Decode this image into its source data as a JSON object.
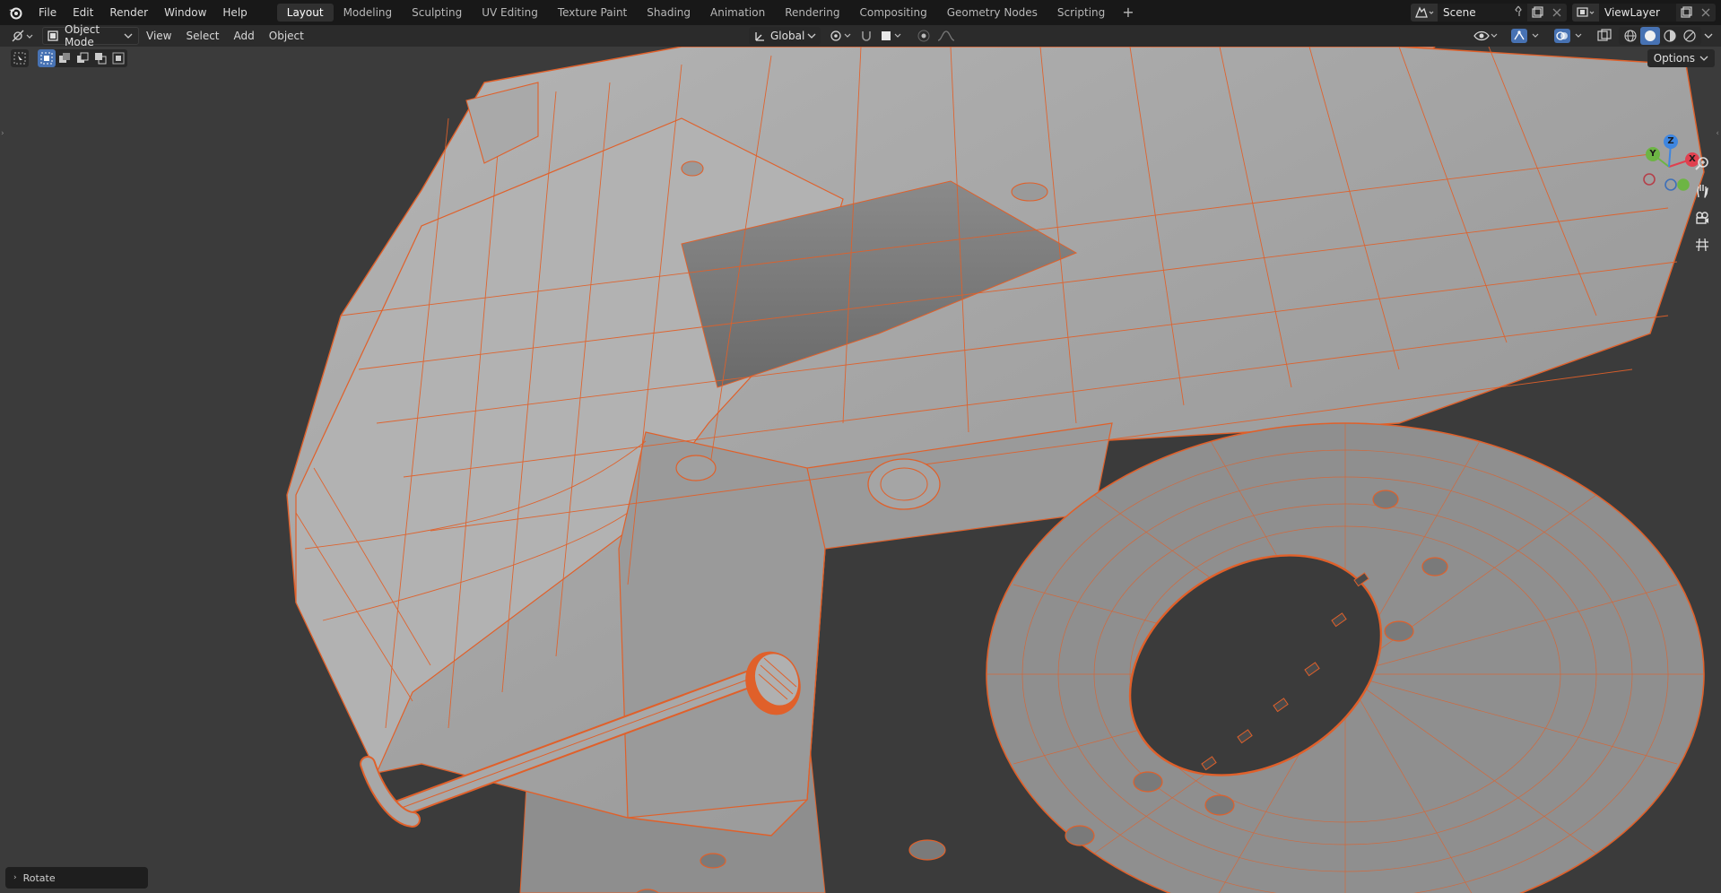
{
  "topbar": {
    "menus": [
      "File",
      "Edit",
      "Render",
      "Window",
      "Help"
    ],
    "workspaces": [
      "Layout",
      "Modeling",
      "Sculpting",
      "UV Editing",
      "Texture Paint",
      "Shading",
      "Animation",
      "Rendering",
      "Compositing",
      "Geometry Nodes",
      "Scripting"
    ],
    "active_workspace": "Layout",
    "add_tab_label": "+",
    "scene_name": "Scene",
    "view_layer_name": "ViewLayer"
  },
  "header": {
    "mode": "Object Mode",
    "menus": [
      "View",
      "Select",
      "Add",
      "Object"
    ],
    "orientation": "Global"
  },
  "toolbar": {
    "options_label": "Options"
  },
  "gizmo": {
    "x_label": "X",
    "y_label": "Y",
    "z_label": "Z",
    "x_color": "#e0404f",
    "y_color": "#6db544",
    "z_color": "#3e86e0"
  },
  "last_operator": {
    "label": "Rotate"
  },
  "colors": {
    "background": "#3a3a3a",
    "topbar": "#181818",
    "header": "#2b2b2b",
    "accent": "#4772b3",
    "wire": "#e0602a",
    "mesh": "#a8a8a8"
  }
}
